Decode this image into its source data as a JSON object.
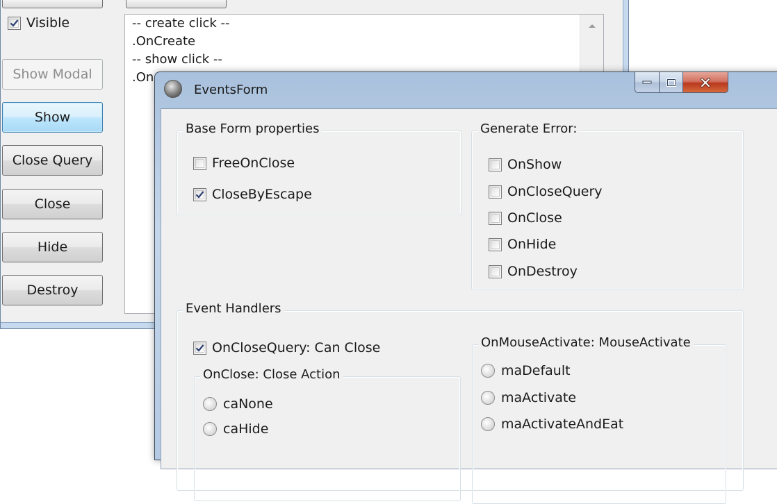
{
  "back_window": {
    "visible_checkbox": {
      "label": "Visible",
      "checked": true
    },
    "buttons": [
      {
        "label": "Show Modal",
        "state": "disabled"
      },
      {
        "label": "Show",
        "state": "focused"
      },
      {
        "label": "Close Query",
        "state": "normal"
      },
      {
        "label": "Close",
        "state": "normal"
      },
      {
        "label": "Hide",
        "state": "normal"
      },
      {
        "label": "Destroy",
        "state": "normal"
      }
    ],
    "log_memo": {
      "lines": [
        "-- create click --",
        ".OnCreate",
        "-- show click --",
        ".On"
      ]
    }
  },
  "front_window": {
    "title": "EventsForm",
    "base_form_properties": {
      "title": "Base Form properties",
      "items": [
        {
          "label": "FreeOnClose",
          "checked": false
        },
        {
          "label": "CloseByEscape",
          "checked": true
        }
      ]
    },
    "generate_error": {
      "title": "Generate Error:",
      "items": [
        {
          "label": "OnShow",
          "checked": false
        },
        {
          "label": "OnCloseQuery",
          "checked": false
        },
        {
          "label": "OnClose",
          "checked": false
        },
        {
          "label": "OnHide",
          "checked": false
        },
        {
          "label": "OnDestroy",
          "checked": false
        }
      ]
    },
    "event_handlers": {
      "title": "Event Handlers",
      "can_close": {
        "label": "OnCloseQuery: Can Close",
        "checked": true
      },
      "close_action": {
        "title": "OnClose: Close Action",
        "options": [
          "caNone",
          "caHide"
        ]
      },
      "mouse_activate": {
        "title": "OnMouseActivate: MouseActivate",
        "options": [
          "maDefault",
          "maActivate",
          "maActivateAndEat"
        ]
      }
    }
  }
}
